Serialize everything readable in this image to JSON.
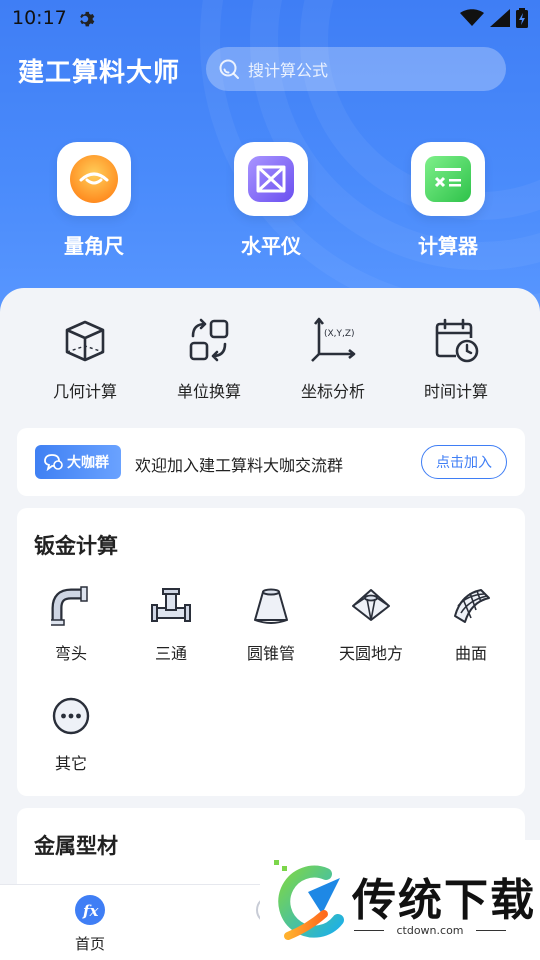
{
  "status_bar": {
    "time": "10:17"
  },
  "header": {
    "app_title": "建工算料大师",
    "search_placeholder": "搜计算公式"
  },
  "tools": [
    {
      "label": "量角尺",
      "icon": "protractor-icon"
    },
    {
      "label": "水平仪",
      "icon": "level-icon"
    },
    {
      "label": "计算器",
      "icon": "calculator-icon"
    }
  ],
  "quick_actions": [
    {
      "label": "几何计算",
      "icon": "cube-icon"
    },
    {
      "label": "单位换算",
      "icon": "unit-convert-icon"
    },
    {
      "label": "坐标分析",
      "icon": "coordinate-axes-icon",
      "icon_text": "(X,Y,Z)"
    },
    {
      "label": "时间计算",
      "icon": "calendar-clock-icon"
    }
  ],
  "banner": {
    "badge": "大咖群",
    "text": "欢迎加入建工算料大咖交流群",
    "button": "点击加入"
  },
  "sheet_metal": {
    "title": "钣金计算",
    "items": [
      {
        "label": "弯头",
        "icon": "elbow-pipe-icon"
      },
      {
        "label": "三通",
        "icon": "tee-pipe-icon"
      },
      {
        "label": "圆锥管",
        "icon": "cone-pipe-icon"
      },
      {
        "label": "天圆地方",
        "icon": "round-to-square-icon"
      },
      {
        "label": "曲面",
        "icon": "curved-surface-icon"
      },
      {
        "label": "其它",
        "icon": "more-icon"
      }
    ]
  },
  "metal_profiles": {
    "title": "金属型材"
  },
  "bottom_nav": [
    {
      "label": "首页",
      "icon": "fx-icon",
      "active": true
    },
    {
      "label": "",
      "icon": "profile-icon",
      "active": false
    }
  ],
  "watermark": {
    "brand": "传统下载",
    "url": "ctdown.com"
  },
  "colors": {
    "primary": "#3f7ef5",
    "hero_top": "#3f7ef5",
    "hero_bottom": "#5a98ff",
    "background": "#f2f4f8",
    "text": "#222222"
  }
}
